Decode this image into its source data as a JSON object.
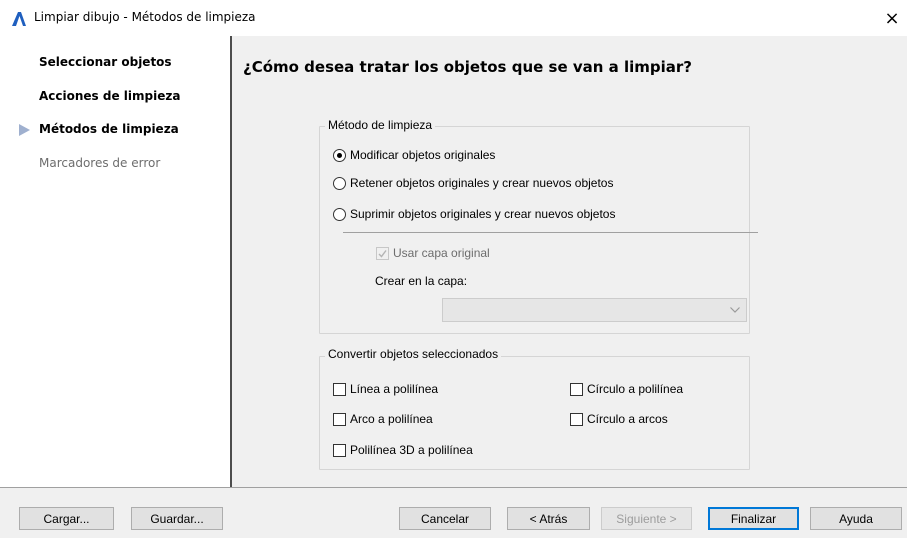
{
  "window": {
    "title": "Limpiar dibujo - Métodos de limpieza",
    "close_glyph": "×",
    "logo_color": "#1f5fbf"
  },
  "nav": {
    "items": [
      {
        "label": "Seleccionar objetos",
        "state": "done"
      },
      {
        "label": "Acciones de limpieza",
        "state": "done"
      },
      {
        "label": "Métodos de limpieza",
        "state": "current"
      },
      {
        "label": "Marcadores de error",
        "state": "disabled"
      }
    ]
  },
  "main": {
    "heading": "¿Cómo desea tratar los objetos que se van a limpiar?",
    "method_group": {
      "legend": "Método de limpieza",
      "options": [
        {
          "label": "Modificar objetos originales",
          "selected": true
        },
        {
          "label": "Retener objetos originales y crear nuevos objetos",
          "selected": false
        },
        {
          "label": "Suprimir objetos originales y crear nuevos objetos",
          "selected": false
        }
      ],
      "use_original_layer": {
        "label": "Usar capa original",
        "checked": true,
        "enabled": false
      },
      "create_layer_label": "Crear en la capa:",
      "layer_value": ""
    },
    "convert_group": {
      "legend": "Convertir objetos seleccionados",
      "options": [
        {
          "label": "Línea a polilínea",
          "checked": false
        },
        {
          "label": "Círculo a polilínea",
          "checked": false
        },
        {
          "label": "Arco a polilínea",
          "checked": false
        },
        {
          "label": "Círculo a arcos",
          "checked": false
        },
        {
          "label": "Polilínea 3D a polilínea",
          "checked": false
        }
      ]
    }
  },
  "footer": {
    "load": "Cargar...",
    "save": "Guardar...",
    "cancel": "Cancelar",
    "back": "< Atrás",
    "next": "Siguiente >",
    "finish": "Finalizar",
    "help": "Ayuda"
  }
}
